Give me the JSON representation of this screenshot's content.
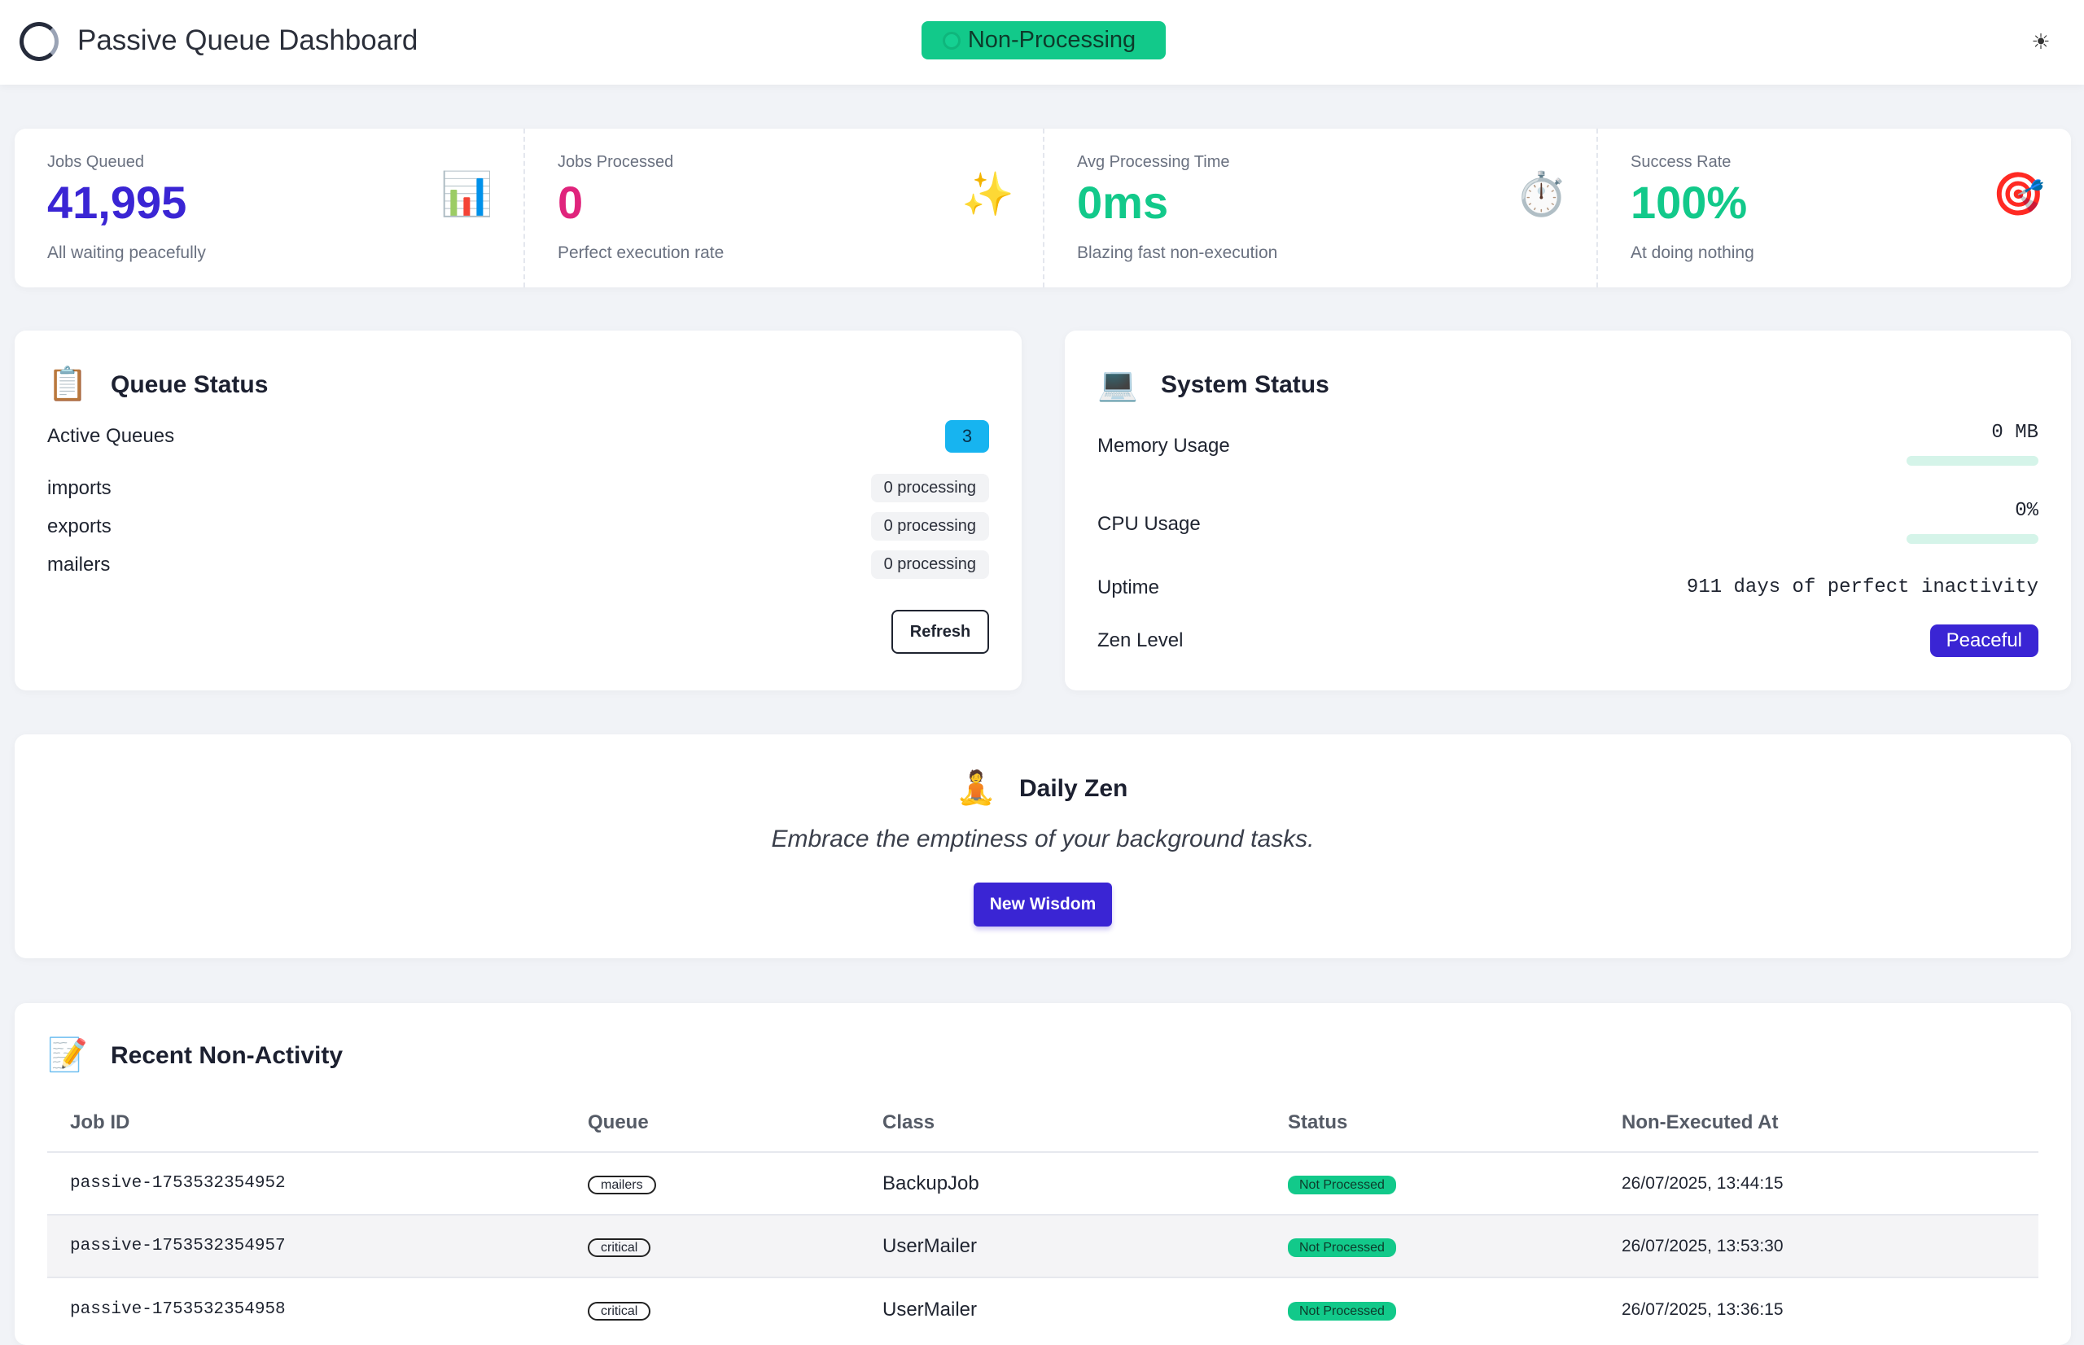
{
  "header": {
    "title": "Passive Queue Dashboard",
    "status": "Non-Processing",
    "theme_icon": "sun-icon"
  },
  "stats": [
    {
      "label": "Jobs Queued",
      "value": "41,995",
      "sub": "All waiting peacefully",
      "icon": "📊",
      "icon_name": "bar-chart-icon",
      "color": "#3a25d4"
    },
    {
      "label": "Jobs Processed",
      "value": "0",
      "sub": "Perfect execution rate",
      "icon": "✨",
      "icon_name": "sparkles-icon",
      "color": "#e0247c"
    },
    {
      "label": "Avg Processing Time",
      "value": "0ms",
      "sub": "Blazing fast non-execution",
      "icon": "⏱️",
      "icon_name": "stopwatch-icon",
      "color": "#12c98a"
    },
    {
      "label": "Success Rate",
      "value": "100%",
      "sub": "At doing nothing",
      "icon": "🎯",
      "icon_name": "target-icon",
      "color": "#12c98a"
    }
  ],
  "queue_status": {
    "title": "Queue Status",
    "icon": "📋",
    "active_label": "Active Queues",
    "active_count": "3",
    "queues": [
      {
        "name": "imports",
        "status": "0 processing"
      },
      {
        "name": "exports",
        "status": "0 processing"
      },
      {
        "name": "mailers",
        "status": "0 processing"
      }
    ],
    "refresh_label": "Refresh"
  },
  "system_status": {
    "title": "System Status",
    "icon": "💻",
    "memory_label": "Memory Usage",
    "memory_value": "0 MB",
    "memory_fraction": 0,
    "cpu_label": "CPU Usage",
    "cpu_value": "0%",
    "cpu_fraction": 0,
    "uptime_label": "Uptime",
    "uptime_value": "911 days of perfect inactivity",
    "zen_label": "Zen Level",
    "zen_value": "Peaceful"
  },
  "daily_zen": {
    "title": "Daily Zen",
    "icon": "🧘",
    "quote": "Embrace the emptiness of your background tasks.",
    "button": "New Wisdom"
  },
  "recent": {
    "title": "Recent Non-Activity",
    "icon": "📝",
    "columns": [
      "Job ID",
      "Queue",
      "Class",
      "Status",
      "Non-Executed At"
    ],
    "rows": [
      {
        "id": "passive-1753532354952",
        "queue": "mailers",
        "class": "BackupJob",
        "status": "Not Processed",
        "at": "26/07/2025, 13:44:15"
      },
      {
        "id": "passive-1753532354957",
        "queue": "critical",
        "class": "UserMailer",
        "status": "Not Processed",
        "at": "26/07/2025, 13:53:30"
      },
      {
        "id": "passive-1753532354958",
        "queue": "critical",
        "class": "UserMailer",
        "status": "Not Processed",
        "at": "26/07/2025, 13:36:15"
      }
    ]
  }
}
